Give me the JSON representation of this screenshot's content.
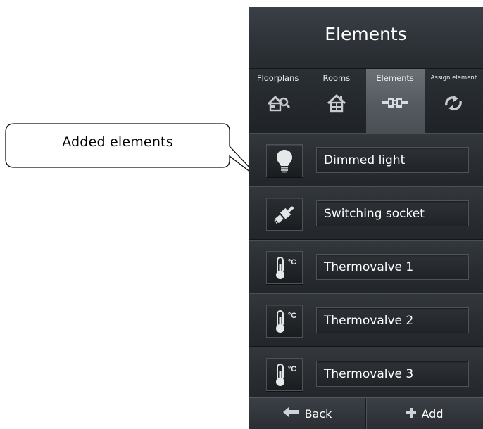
{
  "callout": {
    "text": "Added elements"
  },
  "header": {
    "title": "Elements"
  },
  "tabs": [
    {
      "label": "Floorplans",
      "icon": "floorplan-icon",
      "active": false
    },
    {
      "label": "Rooms",
      "icon": "rooms-icon",
      "active": false
    },
    {
      "label": "Elements",
      "icon": "elements-icon",
      "active": true
    },
    {
      "label": "Assign element",
      "icon": "assign-icon",
      "active": false
    }
  ],
  "elements": [
    {
      "name": "Dimmed light",
      "icon": "light-bulb-icon"
    },
    {
      "name": "Switching socket",
      "icon": "socket-plug-icon"
    },
    {
      "name": "Thermovalve 1",
      "icon": "thermometer-icon"
    },
    {
      "name": "Thermovalve 2",
      "icon": "thermometer-icon"
    },
    {
      "name": "Thermovalve 3",
      "icon": "thermometer-icon"
    }
  ],
  "thermo_unit": "°C",
  "footer": {
    "back_label": "Back",
    "add_label": "Add"
  },
  "colors": {
    "panel": "#23272b",
    "active_tab": "#5a6066",
    "text": "#ffffff"
  }
}
